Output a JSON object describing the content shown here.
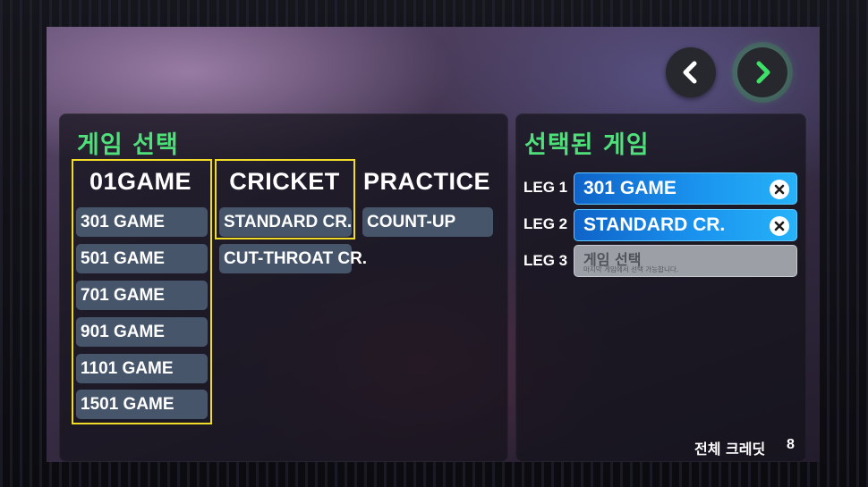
{
  "nav": {
    "prev_icon": "chevron-left-icon",
    "next_icon": "chevron-right-icon",
    "next_color": "#3ee067"
  },
  "game_select": {
    "title": "게임 선택",
    "columns": [
      {
        "header": "01GAME",
        "items": [
          "301 GAME",
          "501 GAME",
          "701 GAME",
          "901 GAME",
          "1101 GAME",
          "1501 GAME"
        ]
      },
      {
        "header": "CRICKET",
        "items": [
          "STANDARD CR.",
          "CUT-THROAT CR."
        ]
      },
      {
        "header": "PRACTICE",
        "items": [
          "COUNT-UP"
        ]
      }
    ]
  },
  "selected_games": {
    "title": "선택된 게임",
    "legs": [
      {
        "label": "LEG 1",
        "game": "301 GAME",
        "remove_icon": "close-icon"
      },
      {
        "label": "LEG 2",
        "game": "STANDARD CR.",
        "remove_icon": "close-icon"
      },
      {
        "label": "LEG 3",
        "placeholder_title": "게임 선택",
        "placeholder_sub": "마지막 게임에서 선택 가능합니다."
      }
    ]
  },
  "footer": {
    "credits_label": "전체 크레딧",
    "credits_value": "8"
  },
  "colors": {
    "accent_green": "#4fe07a",
    "highlight_yellow": "#f2dc2a",
    "leg_blue": "#1a93ee",
    "button_slate": "#46556a"
  }
}
